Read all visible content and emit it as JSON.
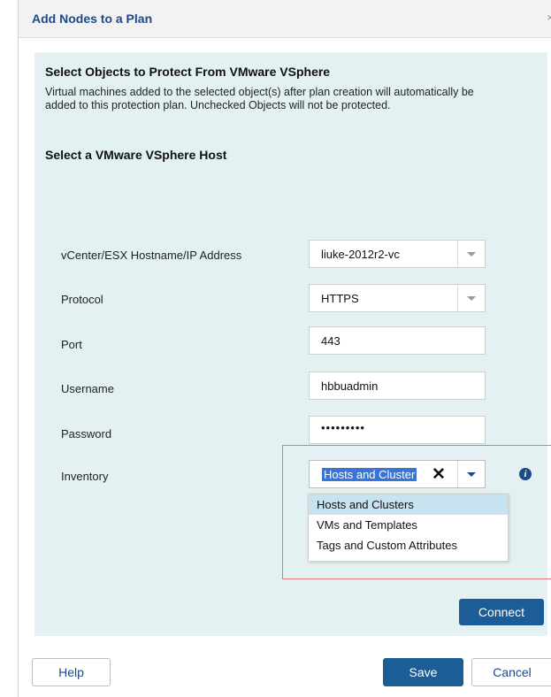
{
  "dialog": {
    "title": "Add Nodes to a Plan",
    "close_glyph": "×"
  },
  "panel": {
    "heading": "Select Objects to Protect From VMware VSphere",
    "description": "Virtual machines added to the selected object(s) after plan creation will automatically be added to this protection plan. Unchecked Objects will not be protected.",
    "subheading": "Select a VMware VSphere Host"
  },
  "form": {
    "hostname": {
      "label": "vCenter/ESX Hostname/IP Address",
      "value": "liuke-2012r2-vc"
    },
    "protocol": {
      "label": "Protocol",
      "value": "HTTPS"
    },
    "port": {
      "label": "Port",
      "value": "443"
    },
    "username": {
      "label": "Username",
      "value": "hbbuadmin"
    },
    "password": {
      "label": "Password",
      "value": "•••••••••"
    },
    "inventory": {
      "label": "Inventory",
      "value": "Hosts and Cluster",
      "clear_glyph": "✕",
      "info_glyph": "i",
      "options": [
        "Hosts and Clusters",
        "VMs and Templates",
        "Tags and Custom Attributes"
      ],
      "selected_option": "Hosts and Clusters"
    }
  },
  "buttons": {
    "connect": "Connect",
    "help": "Help",
    "save": "Save",
    "cancel": "Cancel"
  },
  "colors": {
    "accent": "#1c5d97",
    "panel_bg": "#e3f1f3",
    "highlight_border": "#e07878",
    "selected_option_bg": "#c6e3ef"
  }
}
